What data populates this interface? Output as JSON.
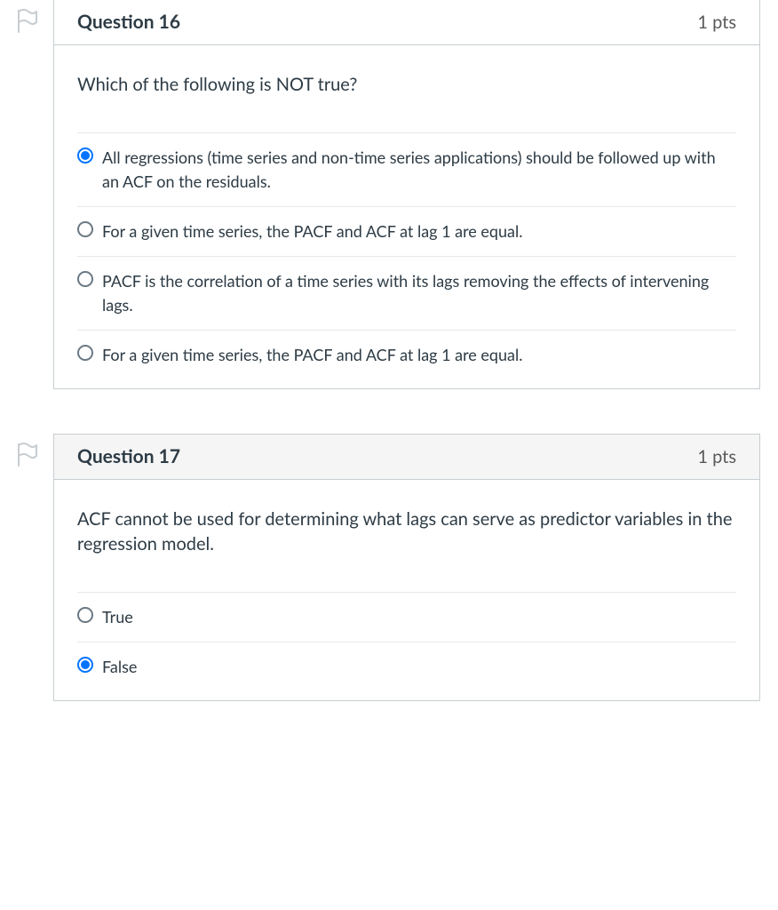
{
  "questions": [
    {
      "title": "Question 16",
      "points": "1 pts",
      "prompt": "Which of the following is NOT true?",
      "options": [
        {
          "text": "All regressions (time series and non-time series applications) should be followed up with an ACF on the residuals.",
          "selected": true
        },
        {
          "text": "For a given time series, the PACF and ACF at lag 1 are equal.",
          "selected": false
        },
        {
          "text": "PACF is the correlation of a time series with its lags removing the effects of intervening lags.",
          "selected": false
        },
        {
          "text": "For a given time series, the PACF and ACF at lag 1 are equal.",
          "selected": false
        }
      ],
      "topBorder": false
    },
    {
      "title": "Question 17",
      "points": "1 pts",
      "prompt": "ACF cannot be used for determining what lags can serve as predictor variables in the regression model.",
      "options": [
        {
          "text": "True",
          "selected": false
        },
        {
          "text": "False",
          "selected": true
        }
      ],
      "topBorder": true
    }
  ]
}
